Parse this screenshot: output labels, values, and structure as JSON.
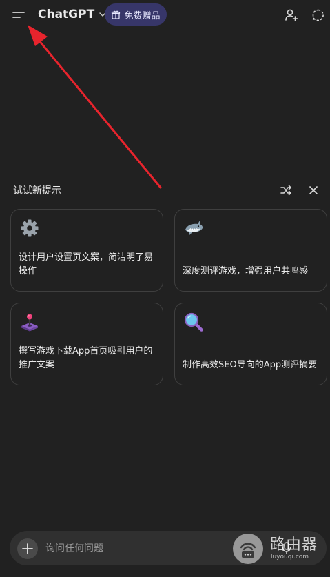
{
  "header": {
    "app_title": "ChatGPT",
    "promo_label": "免费赠品"
  },
  "suggestions": {
    "title": "试试新提示",
    "cards": [
      {
        "icon": "gear-emoji-icon",
        "text": "设计用户设置页文案，简洁明了易操作"
      },
      {
        "icon": "shark-emoji-icon",
        "text": "深度测评游戏，增强用户共鸣感"
      },
      {
        "icon": "joystick-emoji-icon",
        "text": "撰写游戏下载App首页吸引用户的推广文案"
      },
      {
        "icon": "magnifier-emoji-icon",
        "text": "制作高效SEO导向的App测评摘要"
      }
    ]
  },
  "composer": {
    "placeholder": "询问任何问题"
  },
  "watermark": {
    "name": "路由器",
    "url": "luyouqi.com"
  },
  "colors": {
    "background": "#212121",
    "card_border": "#3f3f3f",
    "promo_bg": "#373669",
    "annotation_arrow": "#e8242d"
  }
}
